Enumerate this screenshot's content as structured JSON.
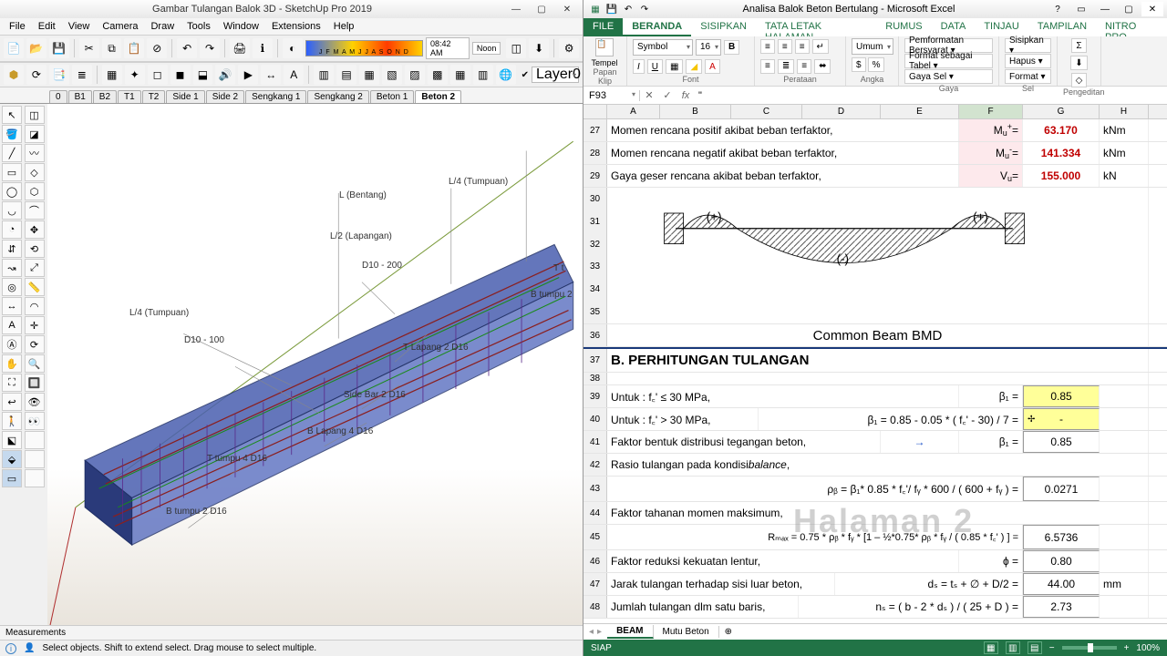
{
  "su": {
    "title": "Gambar Tulangan Balok 3D - SketchUp Pro 2019",
    "menu": [
      "File",
      "Edit",
      "View",
      "Camera",
      "Draw",
      "Tools",
      "Window",
      "Extensions",
      "Help"
    ],
    "time": "08:42 AM",
    "noon": "Noon",
    "months": "J F M A M J J A S O N D",
    "layer": "Layer0",
    "scenes": [
      "0",
      "B1",
      "B2",
      "T1",
      "T2",
      "Side 1",
      "Side 2",
      "Sengkang 1",
      "Sengkang 2",
      "Beton 1",
      "Beton 2"
    ],
    "activeScene": "Beton 2",
    "labels3d": {
      "l4a": "L/4 (Tumpuan)",
      "lbentang": "L (Bentang)",
      "l2": "L/2 (Lapangan)",
      "l4b": "L/4 (Tumpuan)",
      "d10a": "D10 - 200",
      "d10b": "D10 - 100",
      "tlap": "T Lapang 2 D16",
      "side": "Side Bar 2 D16",
      "blap": "B Lapang 4 D16",
      "ttum": "T tumpu 4 D16",
      "btum": "B tumpu 2 D16",
      "tt": "T t",
      "btumpu2": "B tumpu 2"
    },
    "meas": "Measurements",
    "status": "Select objects. Shift to extend select. Drag mouse to select multiple."
  },
  "xl": {
    "title": "Analisa Balok Beton Bertulang - Microsoft Excel",
    "tabs": [
      "FILE",
      "BERANDA",
      "SISIPKAN",
      "TATA LETAK HALAMAN",
      "RUMUS",
      "DATA",
      "TINJAU",
      "TAMPILAN",
      "NITRO PRO"
    ],
    "activeTab": "BERANDA",
    "ribbon": {
      "paste": "Tempel",
      "font": "Symbol",
      "size": "16",
      "numFmt": "Umum",
      "cf": "Pemformatan Bersyarat ▾",
      "tbl": "Format sebagai Tabel ▾",
      "cs": "Gaya Sel ▾",
      "ins": "Sisipkan ▾",
      "del": "Hapus ▾",
      "fmt": "Format ▾",
      "groups": {
        "clip": "Papan Klip",
        "font": "Font",
        "align": "Perataan",
        "num": "Angka",
        "style": "Gaya",
        "cell": "Sel",
        "edit": "Pengeditan"
      }
    },
    "nameBox": "F93",
    "formula": "\"",
    "cols": [
      "A",
      "B",
      "C",
      "D",
      "E",
      "F",
      "G",
      "H"
    ],
    "selCol": "F",
    "rows": {
      "27": {
        "label": "Momen rencana positif akibat beban terfaktor,",
        "sym": "M",
        "sub": "u",
        "sup": "+",
        "val": "63.170",
        "unit": "kNm"
      },
      "28": {
        "label": "Momen rencana negatif akibat beban terfaktor,",
        "sym": "M",
        "sub": "u",
        "sup": "-",
        "val": "141.334",
        "unit": "kNm"
      },
      "29": {
        "label": "Gaya geser rencana akibat beban terfaktor,",
        "sym": "V",
        "sub": "u",
        "sup": "",
        "val": "155.000",
        "unit": "kN"
      },
      "36": "Common Beam BMD",
      "37": "B. PERHITUNGAN TULANGAN",
      "39": {
        "label": "Untuk   :  f꜀'  ≤  30 MPa,",
        "sym": "β₁  =",
        "val": "0.85"
      },
      "40": {
        "label": "Untuk   :  f꜀'  >  30 MPa,",
        "mid": "β₁ = 0.85 - 0.05 * ( f꜀' - 30) / 7  =",
        "val": "-"
      },
      "41": {
        "label": "Faktor bentuk distribusi tegangan beton,",
        "arrow": "→",
        "sym": "β₁  =",
        "val": "0.85"
      },
      "42": "Rasio tulangan pada kondisi balance ,",
      "43": {
        "mid": "ρᵦ = β₁* 0.85 * f꜀'/ fᵧ * 600 / ( 600 + fᵧ )  =",
        "val": "0.0271"
      },
      "44": "Faktor tahanan momen maksimum,",
      "45": {
        "mid": "Rₘₐₓ = 0.75 * ρᵦ * fᵧ * [1 – ½*0.75* ρᵦ * fᵧ / ( 0.85 * f꜀' ) ]  =",
        "val": "6.5736"
      },
      "46": {
        "label": "Faktor reduksi kekuatan lentur,",
        "sym": "ϕ   =",
        "val": "0.80"
      },
      "47": {
        "label": "Jarak tulangan terhadap sisi luar beton,",
        "mid": "dₛ = tₛ + ∅ + D/2 =",
        "val": "44.00",
        "unit": "mm"
      },
      "48": {
        "label": "Jumlah tulangan dlm satu baris,",
        "mid": "nₛ = ( b - 2 * dₛ ) / ( 25 + D )  =",
        "val": "2.73"
      }
    },
    "watermark": "Halaman 2",
    "sheets": [
      "BEAM",
      "Mutu Beton"
    ],
    "activeSheet": "BEAM",
    "status": "SIAP",
    "zoom": "100%"
  }
}
